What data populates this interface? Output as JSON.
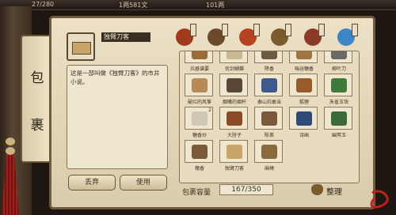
{
  "topbar": {
    "values": [
      "27/280",
      "1两581文",
      "101两"
    ]
  },
  "side_tab": {
    "label_top": "包",
    "label_bottom": "裹"
  },
  "item": {
    "name": "独臂刀客",
    "description": "这是一部叫做《独臂刀客》的市井小说。"
  },
  "buttons": {
    "discard": "丢弃",
    "use": "使用",
    "sort": "整理"
  },
  "capacity": {
    "label": "包裹容量",
    "value": "167/350"
  },
  "categories": [
    {
      "icon": "food-icon",
      "color": "#a23a1b"
    },
    {
      "icon": "weapon-icon",
      "color": "#6b4a2a"
    },
    {
      "icon": "fruit-icon",
      "color": "#b5431f"
    },
    {
      "icon": "bag-icon",
      "color": "#7a5b2c"
    },
    {
      "icon": "book-icon",
      "color": "#8c3a26"
    },
    {
      "icon": "gem-icon",
      "color": "#3a86c7"
    }
  ],
  "inventory": [
    {
      "label": "兵器谱要",
      "qty": "",
      "icon": "scroll-icon",
      "color": "#9b6b3a"
    },
    {
      "label": "忧剑蝴蝶",
      "qty": "",
      "icon": "bowl-icon",
      "color": "#c9b78f"
    },
    {
      "label": "降香",
      "qty": "",
      "icon": "incense-icon",
      "color": "#6d5a44"
    },
    {
      "label": "喘谷糖香",
      "qty": "",
      "icon": "candy-icon",
      "color": "#a0753f"
    },
    {
      "label": "柳叶刀",
      "qty": "",
      "icon": "blade-icon",
      "color": "#6a6a6a"
    },
    {
      "label": "破烂的风筝",
      "qty": "",
      "icon": "kite-icon",
      "color": "#b88a55"
    },
    {
      "label": "烟嘴的烟杆",
      "qty": "",
      "icon": "pipe-icon",
      "color": "#5a4634"
    },
    {
      "label": "泰山石敢当",
      "qty": "",
      "icon": "stone-icon",
      "color": "#3c5a8a"
    },
    {
      "label": "狐狸",
      "qty": "",
      "icon": "fox-icon",
      "color": "#9a5b2a"
    },
    {
      "label": "朱雀玉玦",
      "qty": "",
      "icon": "jade-icon",
      "color": "#3f7a3a"
    },
    {
      "label": "糖香炒",
      "qty": "2",
      "icon": "sugar-icon",
      "color": "#d0c7b5"
    },
    {
      "label": "大肘子",
      "qty": "",
      "icon": "meat-icon",
      "color": "#8a4a24"
    },
    {
      "label": "陈茶",
      "qty": "",
      "icon": "tea-icon",
      "color": "#7a5a3a"
    },
    {
      "label": "诗画",
      "qty": "",
      "icon": "painting-icon",
      "color": "#2e4a78"
    },
    {
      "label": "幽冥玉",
      "qty": "",
      "icon": "dark-jade-icon",
      "color": "#3a6a3a"
    },
    {
      "label": "槐香",
      "qty": "",
      "icon": "log-icon",
      "color": "#7a5a3a"
    },
    {
      "label": "独臂刀客",
      "qty": "",
      "icon": "book-icon",
      "color": "#c9a56a"
    },
    {
      "label": "麻绳",
      "qty": "",
      "icon": "rope-icon",
      "color": "#8a6a3a"
    }
  ]
}
